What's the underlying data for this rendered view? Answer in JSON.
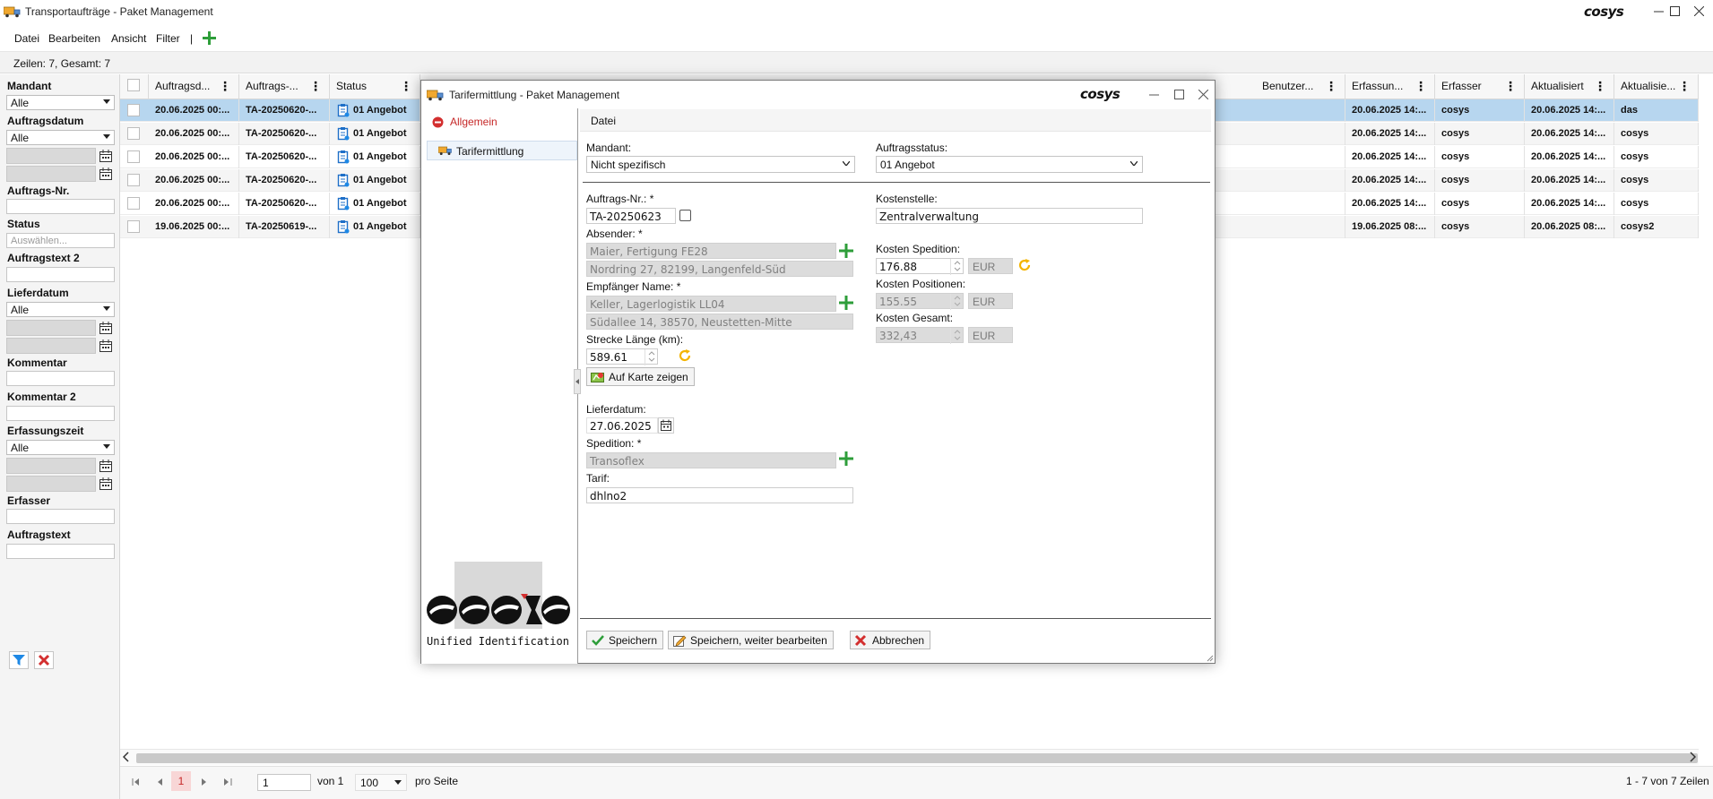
{
  "app": {
    "title": "Transportaufträge - Paket Management",
    "logo_text": "cosys"
  },
  "menu": {
    "items": [
      "Datei",
      "Bearbeiten",
      "Ansicht",
      "Filter",
      "|"
    ]
  },
  "rows_info": "Zeilen: 7, Gesamt: 7",
  "filters": {
    "mandant_label": "Mandant",
    "mandant_value": "Alle",
    "auftragsdatum_label": "Auftragsdatum",
    "auftragsdatum_value": "Alle",
    "auftragsnr_label": "Auftrags-Nr.",
    "status_label": "Status",
    "status_placeholder": "Auswählen...",
    "auftragstext2_label": "Auftragstext 2",
    "lieferdatum_label": "Lieferdatum",
    "lieferdatum_value": "Alle",
    "kommentar_label": "Kommentar",
    "kommentar2_label": "Kommentar 2",
    "erfassungszeit_label": "Erfassungszeit",
    "erfassungszeit_value": "Alle",
    "erfasser_label": "Erfasser",
    "auftragstext_label": "Auftragstext"
  },
  "grid": {
    "columns": [
      "Auftragsd...",
      "Auftrags-...",
      "Status",
      "Benutzer...",
      "Erfassun...",
      "Erfasser",
      "Aktualisiert",
      "Aktualisie..."
    ],
    "rows": [
      [
        "20.06.2025 00:...",
        "TA-20250620-...",
        "01 Angebot",
        "",
        "20.06.2025 14:...",
        "cosys",
        "20.06.2025 14:...",
        "das"
      ],
      [
        "20.06.2025 00:...",
        "TA-20250620-...",
        "01 Angebot",
        "",
        "20.06.2025 14:...",
        "cosys",
        "20.06.2025 14:...",
        "cosys"
      ],
      [
        "20.06.2025 00:...",
        "TA-20250620-...",
        "01 Angebot",
        "",
        "20.06.2025 14:...",
        "cosys",
        "20.06.2025 14:...",
        "cosys"
      ],
      [
        "20.06.2025 00:...",
        "TA-20250620-...",
        "01 Angebot",
        "",
        "20.06.2025 14:...",
        "cosys",
        "20.06.2025 14:...",
        "cosys"
      ],
      [
        "20.06.2025 00:...",
        "TA-20250620-...",
        "01 Angebot",
        "",
        "20.06.2025 14:...",
        "cosys",
        "20.06.2025 14:...",
        "cosys"
      ],
      [
        "19.06.2025 00:...",
        "TA-20250619-...",
        "01 Angebot",
        "",
        "19.06.2025 08:...",
        "cosys",
        "20.06.2025 08:...",
        "cosys2"
      ]
    ]
  },
  "pager": {
    "current_page": "1",
    "page_input": "1",
    "of_pages": "von 1",
    "page_size": "100",
    "per_page_label": "pro Seite",
    "summary": "1 - 7 von 7 Zeilen"
  },
  "dialog": {
    "title": "Tarifermittlung - Paket Management",
    "nav_allgemein": "Allgemein",
    "nav_tarifermittlung": "Tarifermittlung",
    "tab_label": "Datei",
    "mandant_label": "Mandant:",
    "mandant_value": "Nicht spezifisch",
    "auftragsstatus_label": "Auftragsstatus:",
    "auftragsstatus_value": "01 Angebot",
    "auftragsnr_label": "Auftrags-Nr.: *",
    "auftragsnr_value": "TA-20250623",
    "kostenstelle_label": "Kostenstelle:",
    "kostenstelle_value": "Zentralverwaltung",
    "absender_label": "Absender: *",
    "absender_name": "Maier, Fertigung FE28",
    "absender_address": "Nordring 27, 82199, Langenfeld-Süd",
    "empfaenger_label": "Empfänger Name: *",
    "empfaenger_name": "Keller, Lagerlogistik LL04",
    "empfaenger_address": "Südallee 14, 38570, Neustetten-Mitte",
    "strecke_label": "Strecke Länge (km):",
    "strecke_value": "589.61",
    "karte_button": "Auf Karte zeigen",
    "kosten_spedition_label": "Kosten Spedition:",
    "kosten_spedition_value": "176.88",
    "kosten_positionen_label": "Kosten Positionen:",
    "kosten_positionen_value": "155.55",
    "kosten_gesamt_label": "Kosten Gesamt:",
    "kosten_gesamt_value": "332,43",
    "currency": "EUR",
    "lieferdatum_label": "Lieferdatum:",
    "lieferdatum_value": "27.06.2025",
    "spedition_label": "Spedition: *",
    "spedition_value": "Transoflex",
    "tarif_label": "Tarif:",
    "tarif_value": "dhlno2",
    "brand_text": "Unified Identification",
    "save_button": "Speichern",
    "save_continue_button": "Speichern, weiter bearbeiten",
    "cancel_button": "Abbrechen"
  },
  "colors": {
    "selection": "#b7d6ef",
    "accent_green": "#2e9e3a",
    "accent_red": "#d32f2f",
    "refresh_orange": "#f4b400",
    "filter_blue": "#1e88e5"
  },
  "icons": [
    "truck-icon",
    "plus-icon",
    "calendar-icon",
    "status-clipboard-icon",
    "refresh-icon",
    "map-icon",
    "check-icon",
    "edit-icon",
    "close-icon",
    "filter-icon",
    "minimize-icon",
    "maximize-icon"
  ]
}
